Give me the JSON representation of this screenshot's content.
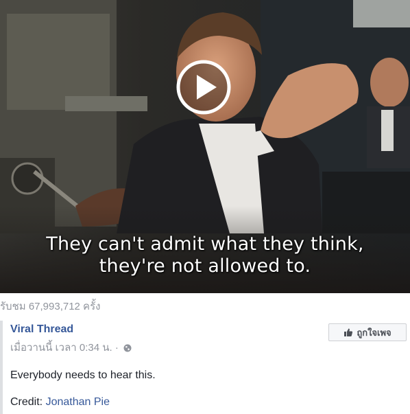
{
  "video": {
    "subtitle_line1": "They can't admit what they think,",
    "subtitle_line2": "they're not allowed to.",
    "play_icon": "play-icon"
  },
  "views": {
    "text": "รับชม 67,993,712 ครั้ง"
  },
  "post": {
    "page_name": "Viral Thread",
    "timestamp": "เมื่อวานนี้ เวลา 0:34 น.",
    "separator": "·",
    "privacy_icon": "globe-icon",
    "like_page_label": "ถูกใจเพจ",
    "like_icon": "thumbs-up-icon",
    "body_text": "Everybody needs to hear this.",
    "credit_prefix": "Credit: ",
    "credit_link": "Jonathan Pie"
  },
  "colors": {
    "link": "#365899",
    "muted": "#90949c",
    "text": "#1d2129"
  }
}
